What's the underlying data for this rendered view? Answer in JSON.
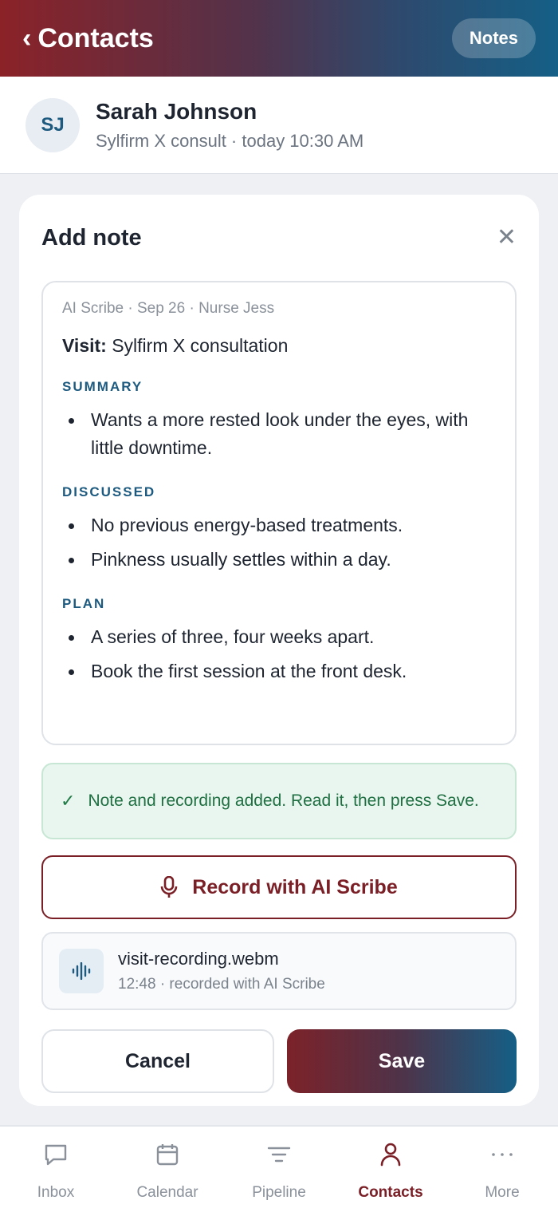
{
  "header": {
    "back_label": "Contacts",
    "back_icon": "chevron-left-icon",
    "notes_label": "Notes"
  },
  "contact": {
    "initials": "SJ",
    "name": "Sarah Johnson",
    "subtitle": "Sylfirm X consult · today 10:30 AM"
  },
  "note_card": {
    "title": "Add note",
    "close_icon": "close-icon",
    "meta": "AI Scribe · Sep 26 · Nurse Jess",
    "visit_label": "Visit:",
    "visit_value": " Sylfirm X consultation",
    "sections": [
      {
        "heading": "SUMMARY",
        "items": [
          "Wants a more rested look under the eyes, with little downtime."
        ]
      },
      {
        "heading": "DISCUSSED",
        "items": [
          "No previous energy-based treatments.",
          "Pinkness usually settles within a day."
        ]
      },
      {
        "heading": "PLAN",
        "items": [
          "A series of three, four weeks apart.",
          "Book the first session at the front desk."
        ]
      }
    ],
    "toast": "Note and recording added. Read it, then press Save.",
    "record_label": "Record with AI Scribe",
    "file_name": "visit-recording.webm",
    "file_sub": "12:48 · recorded with AI Scribe",
    "cancel_label": "Cancel",
    "save_label": "Save"
  },
  "tabs": [
    {
      "label": "Inbox",
      "icon": "chat-bubble-icon",
      "active": false
    },
    {
      "label": "Calendar",
      "icon": "calendar-icon",
      "active": false
    },
    {
      "label": "Pipeline",
      "icon": "filter-lines-icon",
      "active": false
    },
    {
      "label": "Contacts",
      "icon": "person-icon",
      "active": true
    },
    {
      "label": "More",
      "icon": "more-dots-icon",
      "active": false
    }
  ],
  "colors": {
    "brand_red": "#7a1f26",
    "brand_blue": "#155f86",
    "success": "#1f7a46"
  }
}
